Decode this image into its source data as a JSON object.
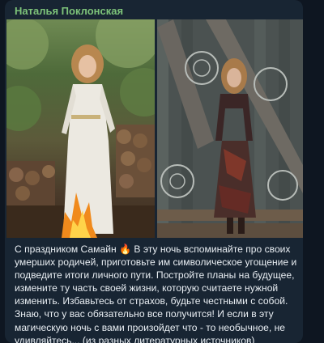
{
  "message": {
    "sender_name": "Наталья Поклонская",
    "sender_color": "#7ec47a",
    "bubble_color": "#182533",
    "background_color": "#0e1621",
    "text_lines": [
      "С праздником Самайн 🔥 В эту ночь вспоминайте про своих",
      "умерших родичей, приготовьте им символическое угощение и",
      "подведите итоги личного пути. Постройте планы на будущее,",
      "измените ту часть своей жизни, которую считаете нужной",
      "изменить. Избавьтесь от страхов, будьте честными с собой.",
      "Знаю, что у вас обязательно все получится! И если в эту",
      "магическую ночь с вами произойдет что - то необычное, не",
      "удивляйтесь... (из разных литературных источников)"
    ],
    "photos": [
      {
        "description_icon": "photo-woman-white-dress-bonfire"
      },
      {
        "description_icon": "photo-woman-wooden-hut"
      }
    ]
  }
}
